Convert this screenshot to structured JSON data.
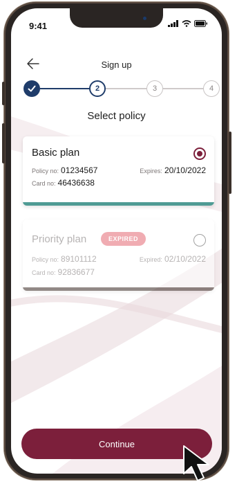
{
  "status_bar": {
    "time": "9:41"
  },
  "header": {
    "title": "Sign up"
  },
  "stepper": {
    "steps": [
      "1",
      "2",
      "3",
      "4"
    ],
    "current_step": 2
  },
  "section_title": "Select policy",
  "policies": [
    {
      "name": "Basic plan",
      "policy_label": "Policy no:",
      "policy_no": "01234567",
      "expiry_label": "Expires:",
      "expiry_date": "20/10/2022",
      "card_label": "Card no:",
      "card_no": "46436638",
      "selected": true,
      "bar_color": "#4f9b94"
    },
    {
      "name": "Priority plan",
      "badge": "EXPIRED",
      "policy_label": "Policy no:",
      "policy_no": "89101112",
      "expiry_label": "Expired:",
      "expiry_date": "02/10/2022",
      "card_label": "Card no:",
      "card_no": "92836677",
      "selected": false,
      "bar_color": "#3a2a24"
    }
  ],
  "continue_label": "Continue",
  "colors": {
    "primary": "#7c1f3b",
    "stepper": "#1f3c6a",
    "badge": "#e46a75"
  }
}
